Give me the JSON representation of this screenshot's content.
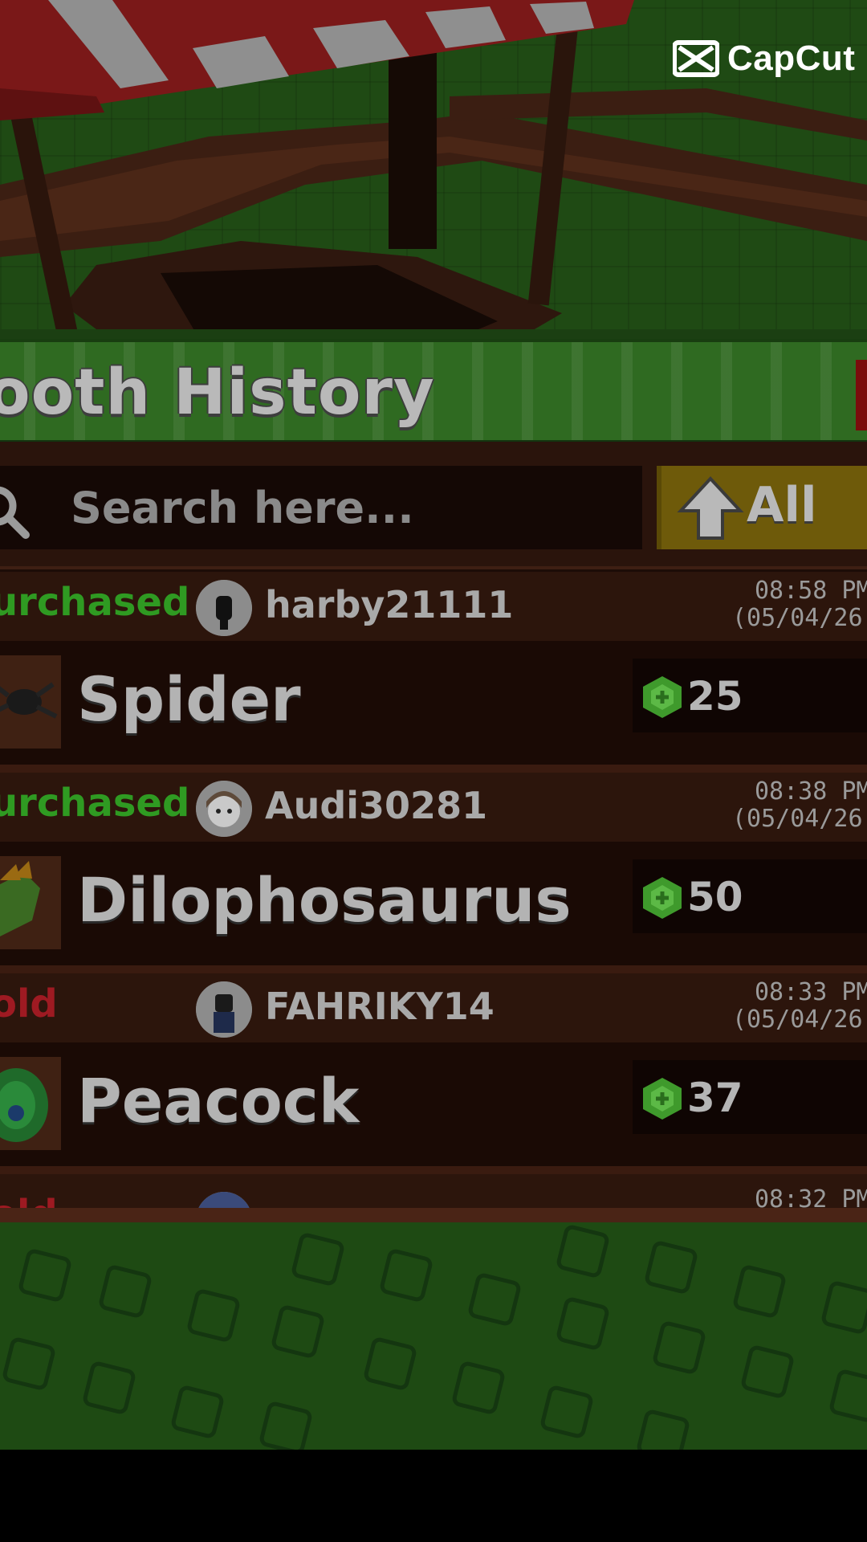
{
  "watermark": {
    "brand": "CapCut",
    "icon": "capcut-logo"
  },
  "panel": {
    "title": "ooth History",
    "search": {
      "placeholder": "Search here...",
      "icon": "search-icon"
    },
    "filter": {
      "label": "All",
      "icon": "arrow-up-icon"
    }
  },
  "entries": [
    {
      "status": "urchased",
      "status_type": "purchased",
      "user": "harby21111",
      "time": "08:58 PM",
      "date": "(05/04/26",
      "item": "Spider",
      "price": "25"
    },
    {
      "status": "urchased",
      "status_type": "purchased",
      "user": "Audi30281",
      "time": "08:38 PM",
      "date": "(05/04/26",
      "item": "Dilophosaurus",
      "price": "50"
    },
    {
      "status": "old",
      "status_type": "sold",
      "user": "FAHRIKY14",
      "time": "08:33 PM",
      "date": "(05/04/26",
      "item": "Peacock",
      "price": "37"
    },
    {
      "status": "old",
      "status_type": "sold",
      "user": "",
      "time": "08:32 PM",
      "date": "",
      "item": "",
      "price": ""
    }
  ],
  "colors": {
    "purchased": "#2f9a22",
    "sold": "#9e1a22",
    "gem": "#3f9a2c",
    "filter_bg": "#6e5a0a"
  }
}
